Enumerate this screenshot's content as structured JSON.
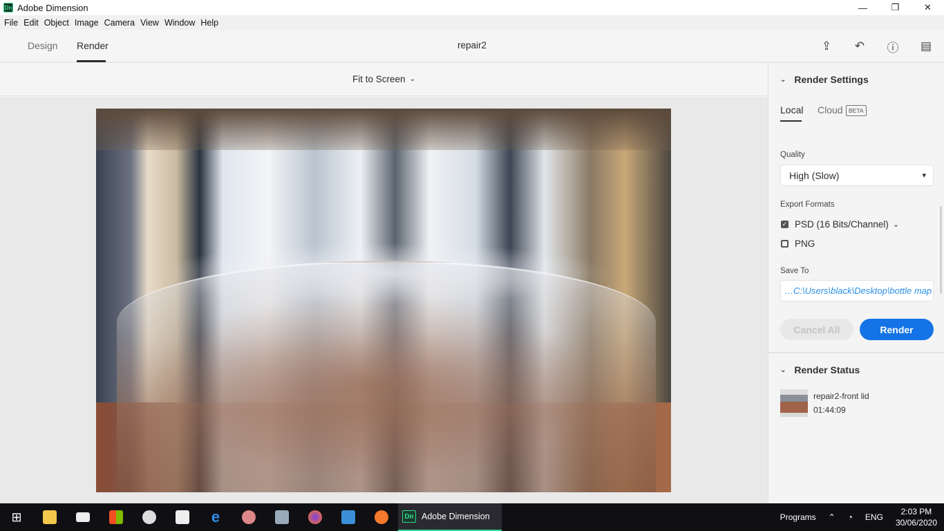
{
  "window": {
    "title": "Adobe Dimension",
    "app_icon": "Dn",
    "minimize": "—",
    "maximize": "❐",
    "close": "✕"
  },
  "menu": [
    "File",
    "Edit",
    "Object",
    "Image",
    "Camera",
    "View",
    "Window",
    "Help"
  ],
  "header": {
    "tabs": [
      "Design",
      "Render"
    ],
    "active_tab": "Render",
    "doc_title": "repair2",
    "icons": [
      "share-icon",
      "undo-icon",
      "help-icon",
      "feedback-icon"
    ]
  },
  "view": {
    "zoom_label": "Fit to Screen"
  },
  "render_settings": {
    "title": "Render Settings",
    "tabs": {
      "local": "Local",
      "cloud": "Cloud",
      "beta": "BETA"
    },
    "quality_label": "Quality",
    "quality_value": "High (Slow)",
    "export_label": "Export Formats",
    "formats": [
      {
        "label": "PSD (16 Bits/Channel)",
        "checked": true
      },
      {
        "label": "PNG",
        "checked": false
      }
    ],
    "save_to_label": "Save To",
    "save_to_value": "…C:\\Users\\black\\Desktop\\bottle map",
    "cancel_label": "Cancel All",
    "render_label": "Render"
  },
  "render_status": {
    "title": "Render Status",
    "items": [
      {
        "name": "repair2-front lid",
        "time": "01:44:09"
      }
    ]
  },
  "taskbar": {
    "active_app": "Adobe Dimension",
    "programs": "Programs",
    "lang": "ENG",
    "time": "2:03 PM",
    "date": "30/06/2020"
  },
  "colors": {
    "accent": "#1473e6",
    "path": "#2b8fe8",
    "dn_green": "#2fdb8f"
  }
}
